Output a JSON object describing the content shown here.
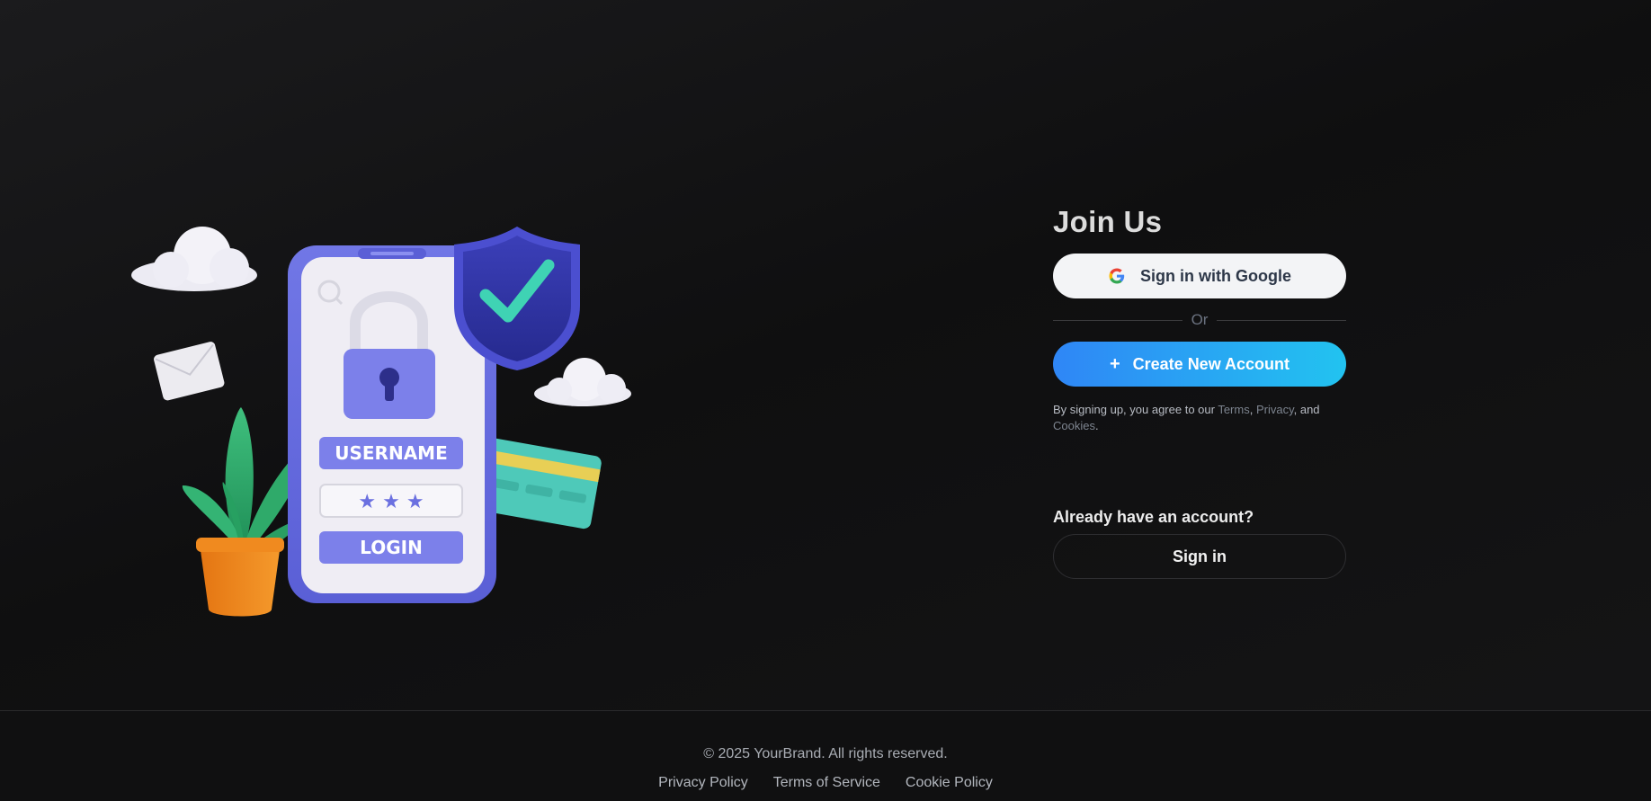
{
  "illustration": {
    "username_label": "USERNAME",
    "password_mask": "★ ★ ★",
    "login_label": "LOGIN"
  },
  "auth": {
    "title": "Join Us",
    "google_button": "Sign in with Google",
    "divider": "Or",
    "create_button": "Create New Account",
    "create_icon": "+",
    "legal": {
      "prefix": "By signing up, you agree to our ",
      "terms": "Terms",
      "sep1": ", ",
      "privacy": "Privacy",
      "sep2": ", and ",
      "cookies": "Cookies",
      "suffix": "."
    },
    "already": "Already have an account?",
    "signin_button": "Sign in"
  },
  "footer": {
    "copyright": "© 2025 YourBrand. All rights reserved.",
    "links": [
      "Privacy Policy",
      "Terms of Service",
      "Cookie Policy"
    ]
  },
  "colors": {
    "background": "#121213",
    "accent_gradient_start": "#2f86f6",
    "accent_gradient_end": "#22c3f0",
    "google_button_bg": "#f3f4f6"
  }
}
